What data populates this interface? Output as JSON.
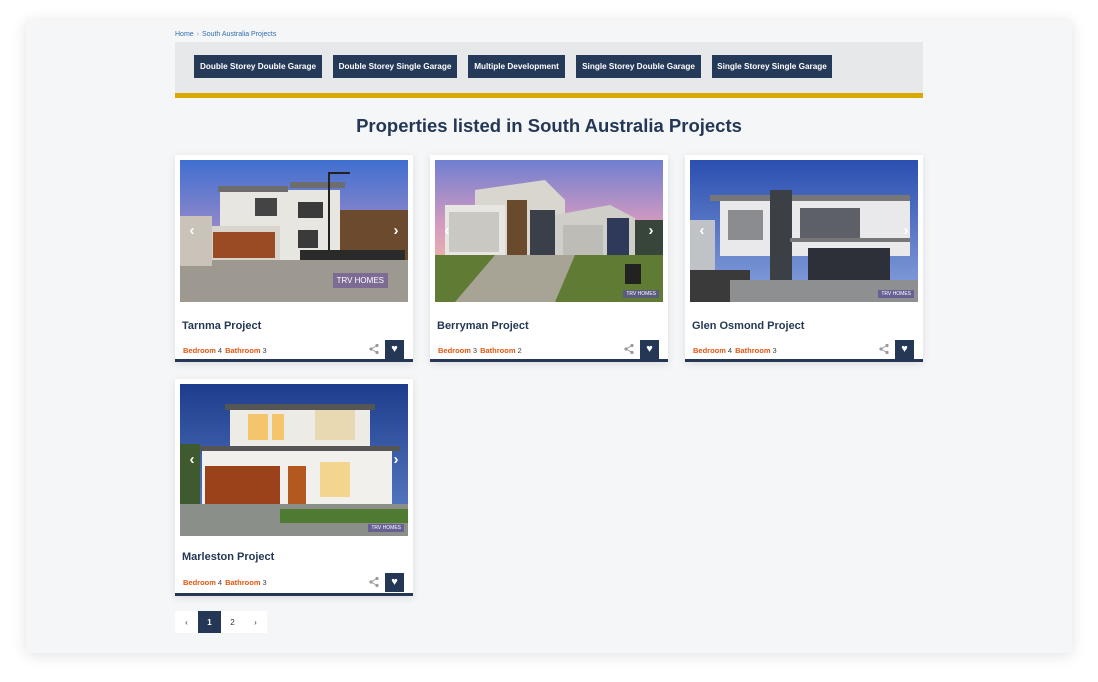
{
  "breadcrumb": {
    "home": "Home",
    "current": "South Australia Projects"
  },
  "filters": [
    "Double Storey Double Garage",
    "Double Storey Single Garage",
    "Multiple Development",
    "Single Storey Double Garage",
    "Single Storey Single Garage"
  ],
  "heading": "Properties listed in South Australia Projects",
  "spec_labels": {
    "bedroom": "Bedroom",
    "bathroom": "Bathroom"
  },
  "cards": [
    {
      "title": "Tarnma Project",
      "bedroom": "4",
      "bathroom": "3",
      "watermark": "TRV HOMES"
    },
    {
      "title": "Berryman Project",
      "bedroom": "3",
      "bathroom": "2",
      "watermark": "TRV HOMES"
    },
    {
      "title": "Glen Osmond Project",
      "bedroom": "4",
      "bathroom": "3",
      "watermark": "TRV HOMES"
    },
    {
      "title": "Marleston Project",
      "bedroom": "4",
      "bathroom": "3",
      "watermark": "TRV HOMES"
    }
  ],
  "icons": {
    "prev": "chevron-left-icon",
    "next": "chevron-right-icon",
    "share": "share-icon",
    "favorite": "heart-icon"
  },
  "pagination": {
    "prev": "‹",
    "pages": [
      "1",
      "2"
    ],
    "next": "›",
    "active": "1"
  },
  "colors": {
    "navy": "#243855",
    "accent_gold": "#d9a900",
    "spec_orange": "#e2550f"
  }
}
